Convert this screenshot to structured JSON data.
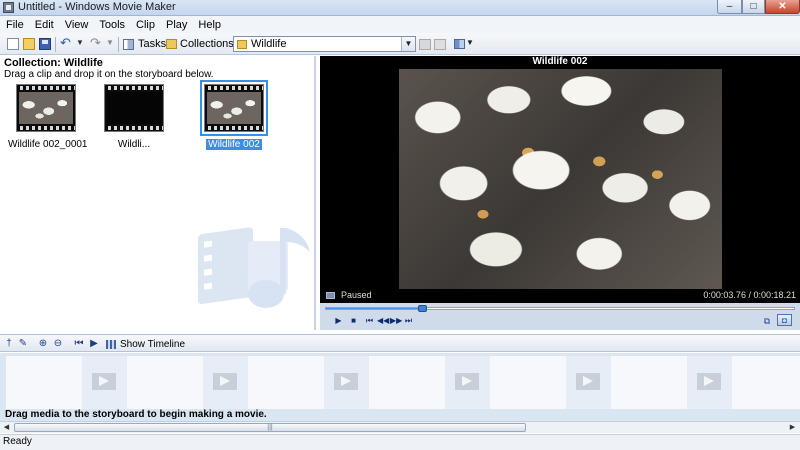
{
  "window": {
    "title": "Untitled - Windows Movie Maker",
    "min": "–",
    "max": "□",
    "close": "✕"
  },
  "menu": [
    "File",
    "Edit",
    "View",
    "Tools",
    "Clip",
    "Play",
    "Help"
  ],
  "toolbar": {
    "undo_icon": "↶",
    "redo_icon": "↷",
    "dropdown": "▼",
    "tasks_label": "Tasks",
    "collections_label": "Collections",
    "collection_selected": "Wildlife"
  },
  "collection": {
    "title": "Collection: Wildlife",
    "hint": "Drag a clip and drop it on the storyboard below.",
    "clips": [
      {
        "label": "Wildlife 002_0001",
        "thumb": "birds"
      },
      {
        "label": "Wildli...",
        "thumb": "dark"
      },
      {
        "label": "Wildlife 002",
        "thumb": "birds",
        "selected": true
      }
    ]
  },
  "monitor": {
    "title": "Wildlife 002",
    "status": "Paused",
    "time": "0:00:03.76 / 0:00:18.21",
    "progress_fraction": 0.206,
    "controls": {
      "play": "▶",
      "stop": "■",
      "prev": "⏮",
      "back": "◀◀",
      "fwd": "▶▶",
      "next": "⏭",
      "split": "⧉",
      "snapshot": "◘"
    }
  },
  "storyboard_toolbar": {
    "icons": {
      "narrate": "†",
      "audio": "✎",
      "zoomin": "⊕",
      "zoomout": "⊖",
      "rewind": "⏮",
      "play": "▶"
    },
    "show_timeline_label": "Show Timeline"
  },
  "storyboard": {
    "hint": "Drag media to the storyboard to begin making a movie.",
    "slot_count": 7,
    "transition_count": 6,
    "scroll_grip": "|||"
  },
  "scroll_arrows": {
    "left": "◀",
    "right": "▶"
  },
  "statusbar": {
    "text": "Ready"
  },
  "colors": {
    "selection": "#3b8ee8",
    "monitor_bg": "#000000",
    "pane_border": "#c7d3e3"
  }
}
